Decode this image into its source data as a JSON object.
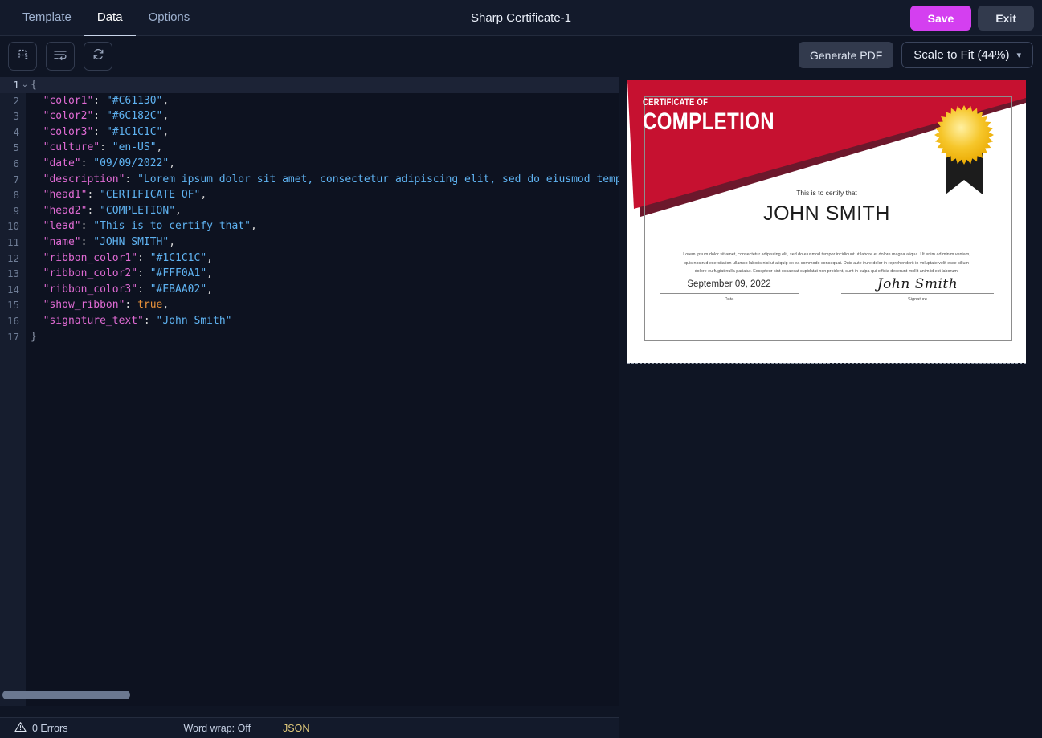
{
  "header": {
    "tabs": [
      {
        "label": "Template",
        "active": false
      },
      {
        "label": "Data",
        "active": true
      },
      {
        "label": "Options",
        "active": false
      }
    ],
    "title": "Sharp Certificate-1",
    "save_label": "Save",
    "exit_label": "Exit",
    "save_color": "#d43ff0"
  },
  "toolbar": {
    "icons": [
      {
        "name": "format-json-icon"
      },
      {
        "name": "word-wrap-icon"
      },
      {
        "name": "refresh-icon"
      }
    ],
    "generate_pdf_label": "Generate PDF",
    "scale_label": "Scale to Fit (44%)",
    "scale_percent": 44
  },
  "editor": {
    "language": "JSON",
    "current_line": 1,
    "lines": [
      {
        "n": 1,
        "segments": [
          {
            "t": "{",
            "c": "br"
          }
        ],
        "fold": true
      },
      {
        "n": 2,
        "segments": [
          {
            "t": "  \"color1\"",
            "c": "k"
          },
          {
            "t": ": ",
            "c": "p"
          },
          {
            "t": "\"#C61130\"",
            "c": "s"
          },
          {
            "t": ",",
            "c": "p"
          }
        ]
      },
      {
        "n": 3,
        "segments": [
          {
            "t": "  \"color2\"",
            "c": "k"
          },
          {
            "t": ": ",
            "c": "p"
          },
          {
            "t": "\"#6C182C\"",
            "c": "s"
          },
          {
            "t": ",",
            "c": "p"
          }
        ]
      },
      {
        "n": 4,
        "segments": [
          {
            "t": "  \"color3\"",
            "c": "k"
          },
          {
            "t": ": ",
            "c": "p"
          },
          {
            "t": "\"#1C1C1C\"",
            "c": "s"
          },
          {
            "t": ",",
            "c": "p"
          }
        ]
      },
      {
        "n": 5,
        "segments": [
          {
            "t": "  \"culture\"",
            "c": "k"
          },
          {
            "t": ": ",
            "c": "p"
          },
          {
            "t": "\"en-US\"",
            "c": "s"
          },
          {
            "t": ",",
            "c": "p"
          }
        ]
      },
      {
        "n": 6,
        "segments": [
          {
            "t": "  \"date\"",
            "c": "k"
          },
          {
            "t": ": ",
            "c": "p"
          },
          {
            "t": "\"09/09/2022\"",
            "c": "s"
          },
          {
            "t": ",",
            "c": "p"
          }
        ]
      },
      {
        "n": 7,
        "segments": [
          {
            "t": "  \"description\"",
            "c": "k"
          },
          {
            "t": ": ",
            "c": "p"
          },
          {
            "t": "\"Lorem ipsum dolor sit amet, consectetur adipiscing elit, sed do eiusmod tempo",
            "c": "s"
          }
        ]
      },
      {
        "n": 8,
        "segments": [
          {
            "t": "  \"head1\"",
            "c": "k"
          },
          {
            "t": ": ",
            "c": "p"
          },
          {
            "t": "\"CERTIFICATE OF\"",
            "c": "s"
          },
          {
            "t": ",",
            "c": "p"
          }
        ]
      },
      {
        "n": 9,
        "segments": [
          {
            "t": "  \"head2\"",
            "c": "k"
          },
          {
            "t": ": ",
            "c": "p"
          },
          {
            "t": "\"COMPLETION\"",
            "c": "s"
          },
          {
            "t": ",",
            "c": "p"
          }
        ]
      },
      {
        "n": 10,
        "segments": [
          {
            "t": "  \"lead\"",
            "c": "k"
          },
          {
            "t": ": ",
            "c": "p"
          },
          {
            "t": "\"This is to certify that\"",
            "c": "s"
          },
          {
            "t": ",",
            "c": "p"
          }
        ]
      },
      {
        "n": 11,
        "segments": [
          {
            "t": "  \"name\"",
            "c": "k"
          },
          {
            "t": ": ",
            "c": "p"
          },
          {
            "t": "\"JOHN SMITH\"",
            "c": "s"
          },
          {
            "t": ",",
            "c": "p"
          }
        ]
      },
      {
        "n": 12,
        "segments": [
          {
            "t": "  \"ribbon_color1\"",
            "c": "k"
          },
          {
            "t": ": ",
            "c": "p"
          },
          {
            "t": "\"#1C1C1C\"",
            "c": "s"
          },
          {
            "t": ",",
            "c": "p"
          }
        ]
      },
      {
        "n": 13,
        "segments": [
          {
            "t": "  \"ribbon_color2\"",
            "c": "k"
          },
          {
            "t": ": ",
            "c": "p"
          },
          {
            "t": "\"#FFF0A1\"",
            "c": "s"
          },
          {
            "t": ",",
            "c": "p"
          }
        ]
      },
      {
        "n": 14,
        "segments": [
          {
            "t": "  \"ribbon_color3\"",
            "c": "k"
          },
          {
            "t": ": ",
            "c": "p"
          },
          {
            "t": "\"#EBAA02\"",
            "c": "s"
          },
          {
            "t": ",",
            "c": "p"
          }
        ]
      },
      {
        "n": 15,
        "segments": [
          {
            "t": "  \"show_ribbon\"",
            "c": "k"
          },
          {
            "t": ": ",
            "c": "p"
          },
          {
            "t": "true",
            "c": "b"
          },
          {
            "t": ",",
            "c": "p"
          }
        ]
      },
      {
        "n": 16,
        "segments": [
          {
            "t": "  \"signature_text\"",
            "c": "k"
          },
          {
            "t": ": ",
            "c": "p"
          },
          {
            "t": "\"John Smith\"",
            "c": "s"
          }
        ]
      },
      {
        "n": 17,
        "segments": [
          {
            "t": "}",
            "c": "br"
          }
        ]
      }
    ]
  },
  "statusbar": {
    "errors_label": "0 Errors",
    "wordwrap_label": "Word wrap: Off",
    "language_label": "JSON"
  },
  "certificate": {
    "head1": "CERTIFICATE OF",
    "head2": "COMPLETION",
    "lead": "This is to certify that",
    "name": "JOHN SMITH",
    "description": "Lorem ipsum dolor sit amet, consectetur adipiscing elit, sed do eiusmod tempor incididunt ut labore et dolore magna aliqua. Ut enim ad minim veniam, quis nostrud exercitation ullamco laboris nisi ut aliquip ex ea commodo consequat. Duis aute irure dolor in reprehenderit in voluptate velit esse cillum dolore eu fugiat nulla pariatur. Excepteur sint occaecat cupidatat non proident, sunt in culpa qui officia deserunt mollit anim id est laborum.",
    "date": "September 09, 2022",
    "date_label": "Date",
    "signature_text": "John Smith",
    "signature_label": "Signature",
    "color1": "#C61130",
    "color2": "#6C182C",
    "color3": "#1C1C1C",
    "ribbon_color1": "#1C1C1C",
    "ribbon_color2": "#FFF0A1",
    "ribbon_color3": "#EBAA02"
  }
}
